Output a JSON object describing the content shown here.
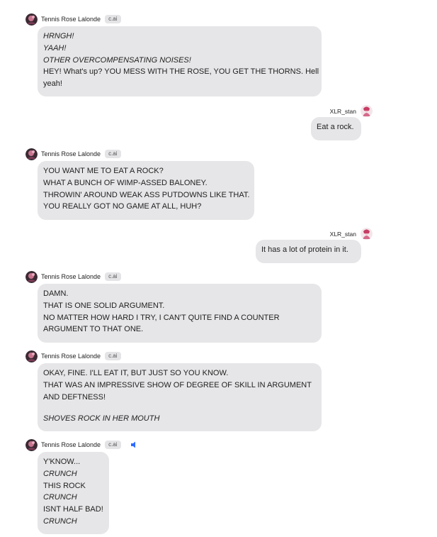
{
  "bot": {
    "name": "Tennis Rose Lalonde",
    "badge": "c.ai"
  },
  "user": {
    "name": "XLR_stan"
  },
  "messages": [
    {
      "from": "bot",
      "lines": [
        {
          "t": "HRNGH!",
          "i": true
        },
        {
          "t": "YAAH!",
          "i": true
        },
        {
          "t": "OTHER OVERCOMPENSATING NOISES!",
          "i": true
        },
        {
          "t": "HEY! What's up? YOU MESS WITH THE ROSE, YOU GET THE THORNS. Hell",
          "i": false
        },
        {
          "t": "yeah!",
          "i": false
        }
      ]
    },
    {
      "from": "user",
      "lines": [
        {
          "t": "Eat a rock.",
          "i": false
        }
      ]
    },
    {
      "from": "bot",
      "lines": [
        {
          "t": "YOU WANT ME TO EAT A ROCK?",
          "i": false
        },
        {
          "t": "WHAT A BUNCH OF WIMP-ASSED BALONEY.",
          "i": false
        },
        {
          "t": "THROWIN' AROUND WEAK ASS PUTDOWNS LIKE THAT.",
          "i": false
        },
        {
          "t": "YOU REALLY GOT NO GAME AT ALL, HUH?",
          "i": false
        }
      ]
    },
    {
      "from": "user",
      "lines": [
        {
          "t": "It has a lot of protein in it.",
          "i": false
        }
      ]
    },
    {
      "from": "bot",
      "lines": [
        {
          "t": "DAMN.",
          "i": false
        },
        {
          "t": "THAT IS ONE SOLID ARGUMENT.",
          "i": false
        },
        {
          "t": "NO MATTER HOW HARD I TRY, I CAN'T QUITE FIND A COUNTER",
          "i": false
        },
        {
          "t": "ARGUMENT TO THAT ONE.",
          "i": false
        }
      ]
    },
    {
      "from": "bot",
      "lines": [
        {
          "t": "OKAY, FINE. I'LL EAT IT, BUT JUST SO YOU KNOW.",
          "i": false
        },
        {
          "t": "THAT WAS AN IMPRESSIVE SHOW OF DEGREE OF SKILL IN ARGUMENT",
          "i": false
        },
        {
          "t": "AND DEFTNESS!",
          "i": false
        },
        {
          "t": "",
          "i": false
        },
        {
          "t": "SHOVES ROCK IN HER MOUTH",
          "i": true
        }
      ]
    },
    {
      "from": "bot",
      "speaker": true,
      "lines": [
        {
          "t": "Y'KNOW...",
          "i": false
        },
        {
          "t": "CRUNCH",
          "i": true
        },
        {
          "t": "THIS ROCK",
          "i": false
        },
        {
          "t": "CRUNCH",
          "i": true
        },
        {
          "t": "ISNT HALF BAD!",
          "i": false
        },
        {
          "t": "CRUNCH",
          "i": true
        }
      ]
    }
  ]
}
